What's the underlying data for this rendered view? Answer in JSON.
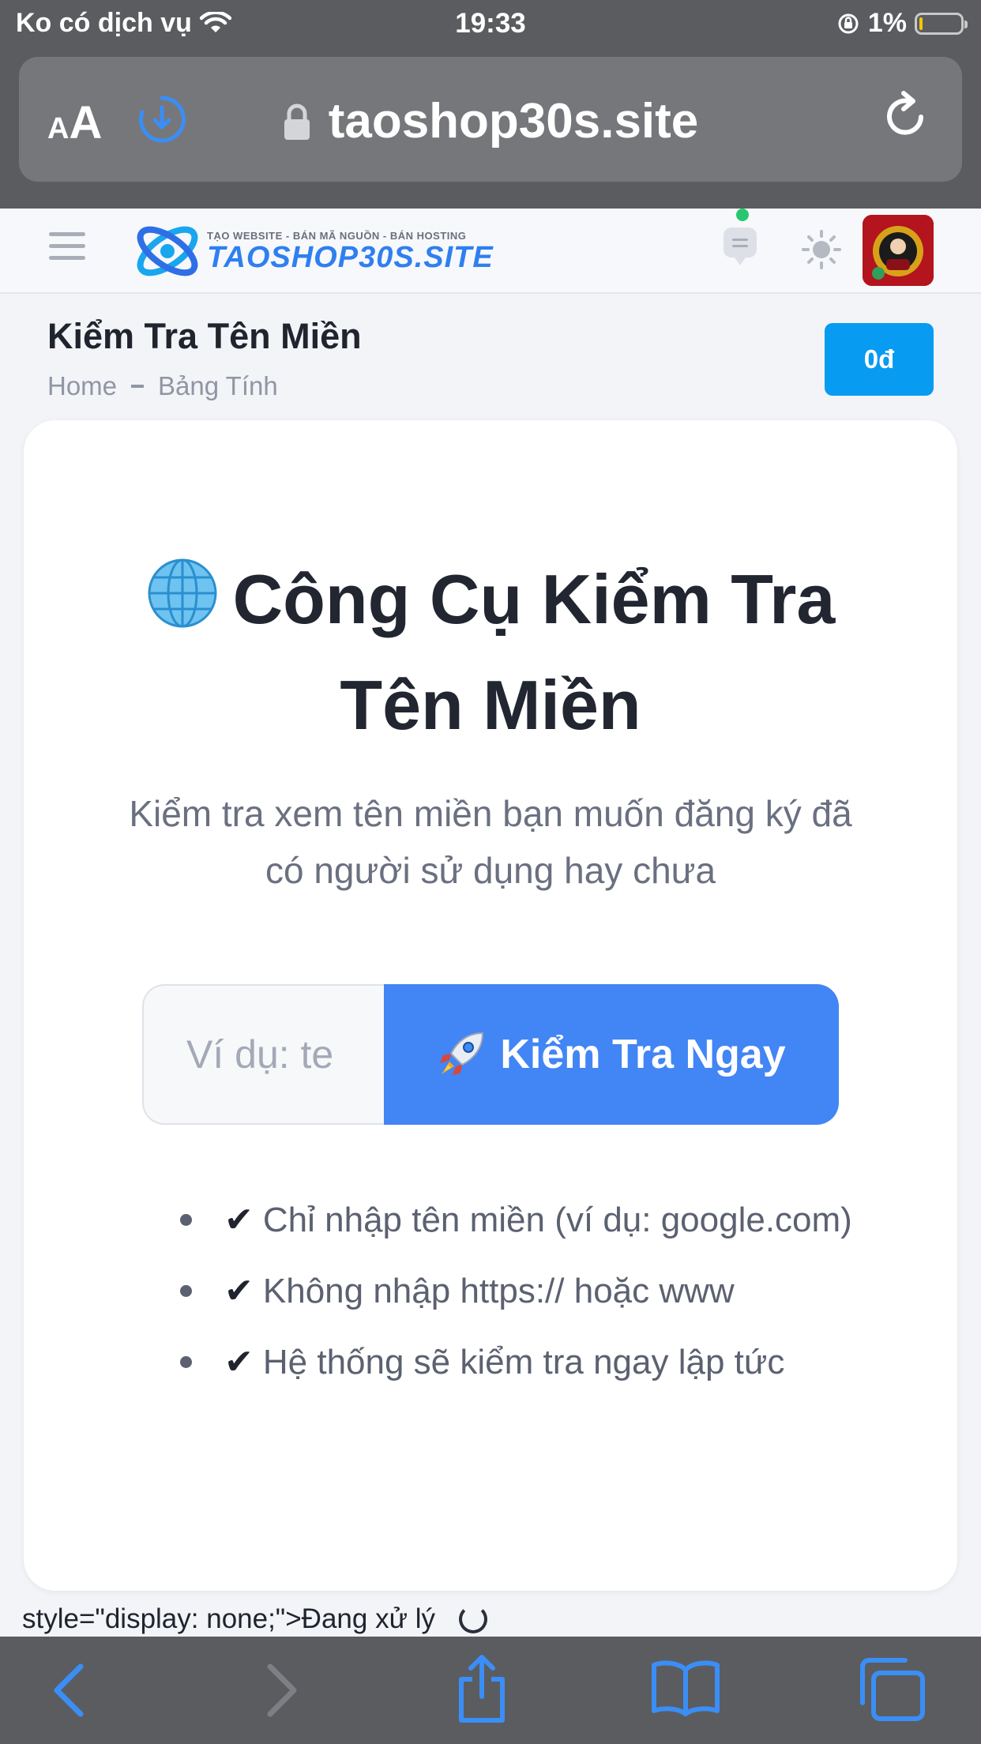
{
  "status_bar": {
    "carrier": "Ko có dịch vụ",
    "time": "19:33",
    "battery": "1%"
  },
  "browser": {
    "text_size_small": "A",
    "text_size_large": "A",
    "url": "taoshop30s.site",
    "icons": [
      "download-icon",
      "lock-icon",
      "reload-icon"
    ]
  },
  "site_header": {
    "logo_tagline": "TẠO WEBSITE - BÁN MÃ NGUỒN - BÁN HOSTING",
    "logo_name": "TAOSHOP30S.SITE",
    "icons": [
      "menu-icon",
      "chat-icon",
      "sun-icon",
      "avatar"
    ]
  },
  "page": {
    "title": "Kiểm Tra Tên Miền",
    "breadcrumb": [
      "Home",
      "Bảng Tính"
    ],
    "balance_label": "0đ"
  },
  "tool": {
    "heading": "Công Cụ Kiểm Tra Tên Miền",
    "subtitle": "Kiểm tra xem tên miền bạn muốn đăng ký đã có người sử dụng hay chưa",
    "input_placeholder": "Ví dụ: te",
    "button_label": "Kiểm Tra Ngay",
    "tips_check": "✔",
    "tips": [
      "Chỉ nhập tên miền (ví dụ: google.com)",
      "Không nhập https:// hoặc www",
      "Hệ thống sẽ kiểm tra ngay lập tức"
    ]
  },
  "leaked_text": "style=\"display: none;\">Đang xử lý",
  "colors": {
    "primary_button": "#4285f4",
    "balance_button": "#089bf2",
    "browser_chrome": "#5b5c60"
  },
  "toolbar": [
    "back-icon",
    "forward-icon",
    "share-icon",
    "bookmarks-icon",
    "tabs-icon"
  ]
}
